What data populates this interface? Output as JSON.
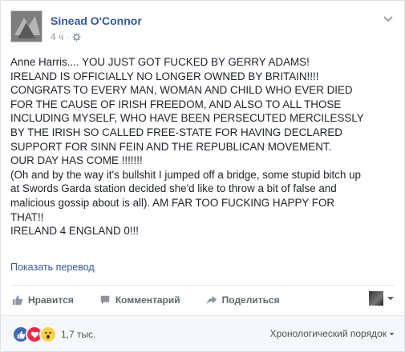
{
  "post": {
    "author": "Sinead O'Connor",
    "time": "4 ч",
    "privacy_icon": "gear-icon",
    "lines": [
      "Anne Harris.... YOU JUST GOT FUCKED BY GERRY ADAMS!",
      "IRELAND IS OFFICIALLY NO LONGER OWNED BY BRITAIN!!!!",
      "CONGRATS TO EVERY MAN, WOMAN AND CHILD WHO EVER DIED",
      "FOR THE CAUSE OF IRISH FREEDOM, AND ALSO TO ALL THOSE",
      "INCLUDING MYSELF, WHO HAVE BEEN PERSECUTED MERCILESSLY",
      "BY THE IRISH SO CALLED FREE-STATE FOR HAVING DECLARED",
      "SUPPORT FOR SINN FEIN AND THE REPUBLICAN MOVEMENT.",
      "OUR DAY HAS COME !!!!!!!",
      "(Oh and by the way it's bullshit I jumped off a bridge, some stupid bitch up",
      "at Swords Garda station decided she'd like to throw a bit of false and",
      "malicious gossip about is all). AM FAR TOO FUCKING HAPPY FOR",
      "THAT!!",
      "IRELAND 4 ENGLAND 0!!!"
    ],
    "translate_label": "Показать перевод"
  },
  "actions": {
    "like_label": "Нравится",
    "comment_label": "Комментарий",
    "share_label": "Поделиться"
  },
  "footer": {
    "reactions": [
      "like",
      "love",
      "wow"
    ],
    "reaction_count": "1,7 тыс.",
    "sort_label": "Хронологический порядок"
  },
  "colors": {
    "link": "#365899",
    "like": "#4267b2",
    "love": "#f0284a",
    "wow": "#fbd14b"
  }
}
